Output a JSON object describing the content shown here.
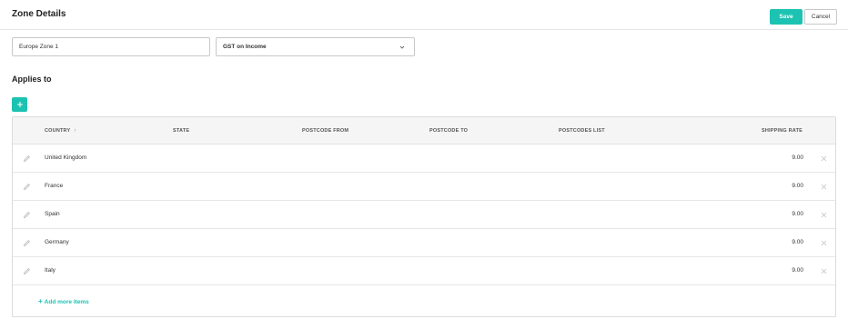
{
  "header": {
    "title": "Zone Details",
    "save_label": "Save",
    "cancel_label": "Cancel"
  },
  "form": {
    "zone_name": "Europe Zone 1",
    "tax_rate": "GST on Income"
  },
  "applies_to": {
    "title": "Applies to",
    "add_icon": "plus-icon",
    "columns": [
      "COUNTRY",
      "STATE",
      "POSTCODE FROM",
      "POSTCODE TO",
      "POSTCODES LIST",
      "SHIPPING RATE"
    ],
    "sort_indicator": "↑",
    "rows": [
      {
        "country": "United Kingdom",
        "rate": "9.00"
      },
      {
        "country": "France",
        "rate": "9.00"
      },
      {
        "country": "Spain",
        "rate": "9.00"
      },
      {
        "country": "Germany",
        "rate": "9.00"
      },
      {
        "country": "Italy",
        "rate": "9.00"
      }
    ],
    "add_more_label": "Add more items",
    "add_more_prefix": "+"
  },
  "colors": {
    "accent": "#1cc3b2",
    "header_bg": "#f5f5f6",
    "border": "#dcdcdc"
  },
  "icons": {
    "edit": "pencil-icon",
    "delete": "close-icon",
    "select": "chevron-down-icon"
  }
}
